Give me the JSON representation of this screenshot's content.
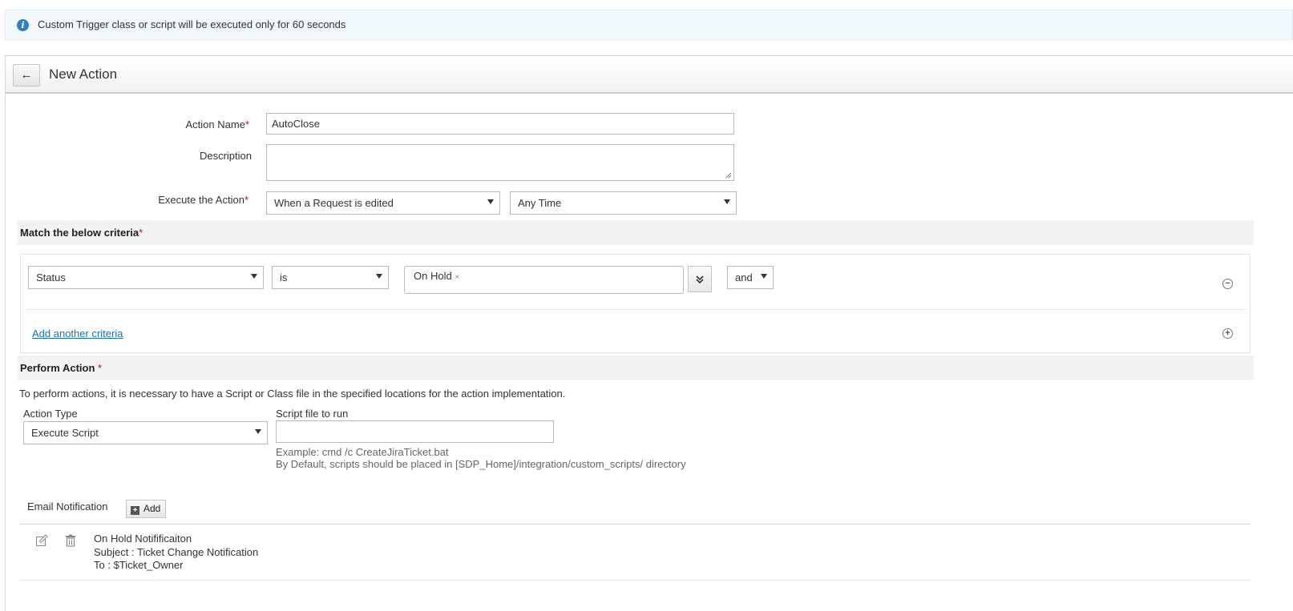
{
  "banner": {
    "icon": "info-icon",
    "text": "Custom Trigger class or script will be executed only for 60 seconds"
  },
  "header": {
    "back_icon": "arrow-left-icon",
    "title": "New Action"
  },
  "form": {
    "action_name": {
      "label": "Action Name",
      "required_mark": "*",
      "value": "AutoClose"
    },
    "description": {
      "label": "Description",
      "value": ""
    },
    "execute": {
      "label": "Execute the Action",
      "required_mark": "*",
      "event_value": "When a Request is edited",
      "time_value": "Any Time"
    }
  },
  "criteria": {
    "title": "Match the below criteria",
    "required_mark": "*",
    "rows": [
      {
        "field": "Status",
        "operator": "is",
        "values": [
          "On Hold"
        ],
        "chip_remove": "×",
        "conjunction": "and"
      }
    ],
    "add_link": "Add another criteria",
    "remove_icon": "minus-circle-icon",
    "add_icon": "plus-circle-icon",
    "expand_icon": "double-chevron-down-icon"
  },
  "perform": {
    "title": "Perform Action",
    "required_mark": "*",
    "description": "To perform actions, it is necessary to have a Script or Class file in the specified locations for the action implementation.",
    "action_type_label": "Action Type",
    "action_type_value": "Execute Script",
    "script_label": "Script file to run",
    "script_value": "",
    "example": "Example: cmd /c CreateJiraTicket.bat",
    "default_note": "By Default, scripts should be placed in [SDP_Home]/integration/custom_scripts/ directory"
  },
  "email": {
    "label": "Email Notification",
    "add_label": "Add",
    "items": [
      {
        "name": "On Hold Notifificaiton",
        "subject": "Subject : Ticket Change Notification",
        "to": "To : $Ticket_Owner"
      }
    ]
  }
}
